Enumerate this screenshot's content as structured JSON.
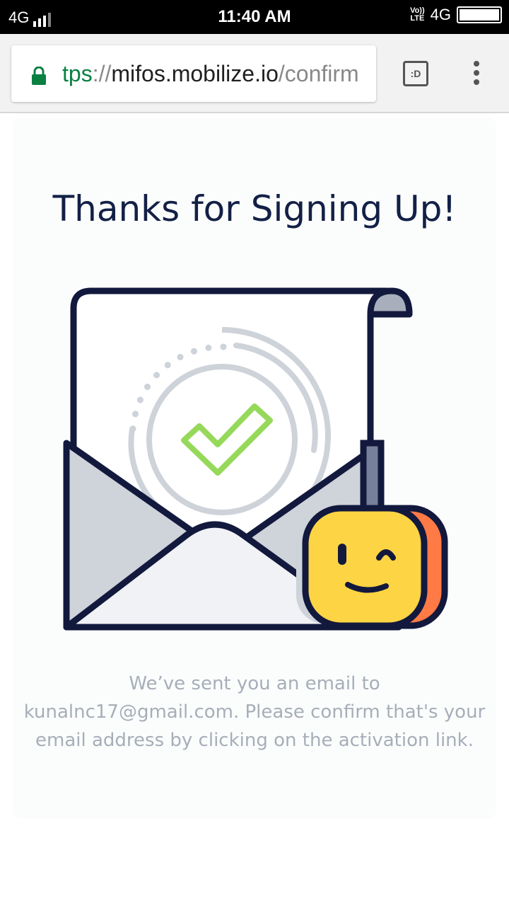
{
  "status_bar": {
    "network_left": "4G",
    "time": "11:40 AM",
    "volte_top": "Vo))",
    "volte_bottom": "LTE",
    "network_right": "4G"
  },
  "browser": {
    "url_scheme": "tps",
    "url_separator": "://",
    "url_host": "mifos.mobilize.io",
    "url_path": "/confirm",
    "reader_label": ":D"
  },
  "page": {
    "title": "Thanks for Signing Up!",
    "message": "We’ve sent you an email to kunalnc17@gmail.com. Please confirm that's your email address by clicking on the activation link."
  },
  "colors": {
    "title": "#132046",
    "message": "#a7aeb8",
    "check": "#96d95a",
    "mascot": "#fdd443",
    "mascot_side": "#ff7a45",
    "outline": "#12193d",
    "lock": "#0b8043"
  }
}
